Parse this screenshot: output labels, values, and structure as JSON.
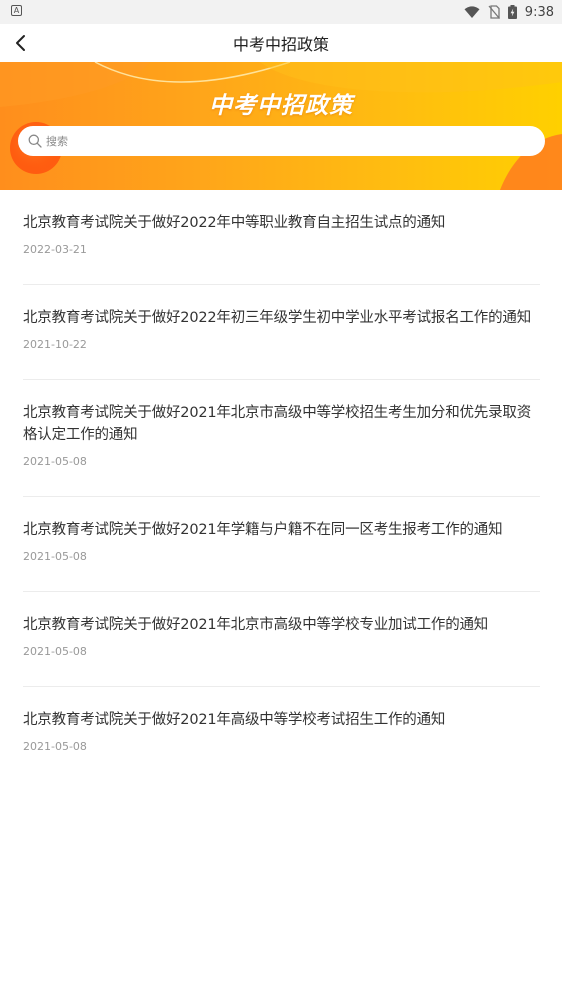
{
  "status_bar": {
    "time": "9:38",
    "left_icon": "A",
    "icons": [
      "wifi-icon",
      "no-sim-icon",
      "battery-charging-icon"
    ]
  },
  "header": {
    "title": "中考中招政策",
    "back_icon": "chevron-left-icon"
  },
  "banner": {
    "title": "中考中招政策",
    "search_placeholder": "搜索",
    "colors": {
      "start": "#ff8e1c",
      "end": "#ffd000"
    }
  },
  "news": [
    {
      "title": "北京教育考试院关于做好2022年中等职业教育自主招生试点的通知",
      "date": "2022-03-21"
    },
    {
      "title": "北京教育考试院关于做好2022年初三年级学生初中学业水平考试报名工作的通知",
      "date": "2021-10-22"
    },
    {
      "title": "北京教育考试院关于做好2021年北京市高级中等学校招生考生加分和优先录取资格认定工作的通知",
      "date": "2021-05-08"
    },
    {
      "title": "北京教育考试院关于做好2021年学籍与户籍不在同一区考生报考工作的通知",
      "date": "2021-05-08"
    },
    {
      "title": "北京教育考试院关于做好2021年北京市高级中等学校专业加试工作的通知",
      "date": "2021-05-08"
    },
    {
      "title": "北京教育考试院关于做好2021年高级中等学校考试招生工作的通知",
      "date": "2021-05-08"
    }
  ]
}
